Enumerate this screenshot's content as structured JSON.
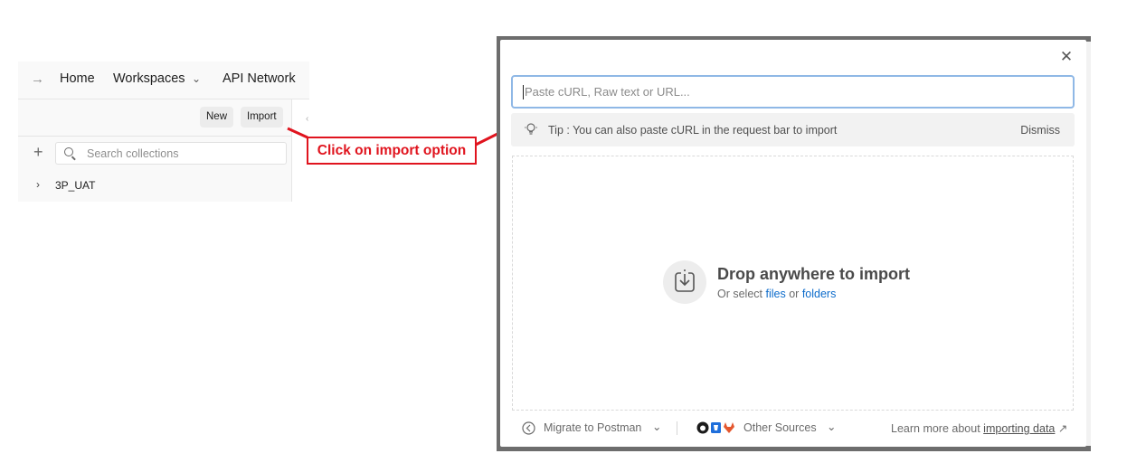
{
  "nav": {
    "home": "Home",
    "workspaces": "Workspaces",
    "api_network": "API Network"
  },
  "sidebar": {
    "new_label": "New",
    "import_label": "Import",
    "search_placeholder": "Search collections",
    "collections": [
      {
        "name": "3P_UAT"
      }
    ]
  },
  "annotation": {
    "text": "Click on import option",
    "color": "#e0141e"
  },
  "import_modal": {
    "input_placeholder": "Paste cURL, Raw text or URL...",
    "tip_text": "Tip : You can also paste cURL in the request bar to import",
    "dismiss_label": "Dismiss",
    "drop_title": "Drop anywhere to import",
    "drop_sub_prefix": "Or select",
    "files_link": "files",
    "or_word": "or",
    "folders_link": "folders",
    "migrate_label": "Migrate to Postman",
    "other_sources_label": "Other Sources",
    "learn_more_prefix": "Learn more about",
    "learn_more_link": "importing data"
  },
  "colors": {
    "link": "#0b6bcb",
    "input_focus_border": "#8fb8e6"
  }
}
